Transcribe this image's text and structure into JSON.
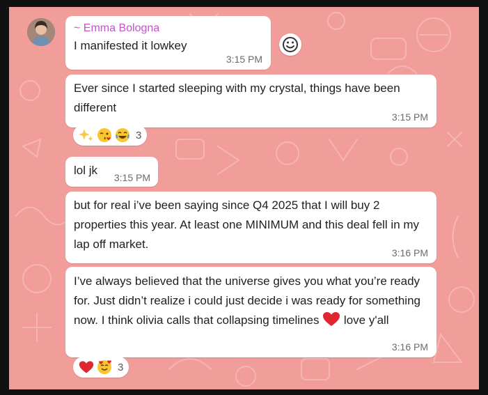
{
  "sender": {
    "name": "~ Emma Bologna"
  },
  "messages": [
    {
      "text": "I manifested it lowkey",
      "time": "3:15 PM"
    },
    {
      "text": "Ever since I started sleeping with my crystal, things have been different",
      "time": "3:15 PM"
    },
    {
      "text": "lol jk",
      "time": "3:15 PM"
    },
    {
      "text": "but for real i’ve been saying since Q4 2025 that I will buy 2 properties this year. At least one MINIMUM and this deal fell in my lap off market.",
      "time": "3:16 PM"
    },
    {
      "text_before_emoji": "I’ve always believed that the universe gives you what you’re ready for. Just didn’t realize i could just decide i was ready for something now. I think olivia calls that collapsing timelines ",
      "text_after_emoji": " love y'all",
      "time": "3:16 PM"
    }
  ],
  "reactions": [
    {
      "icons": [
        "sparkles-emoji",
        "winking-kiss-emoji",
        "tears-of-joy-emoji"
      ],
      "count": "3"
    },
    {
      "icons": [
        "red-heart-emoji",
        "smiling-face-with-hearts-emoji"
      ],
      "count": "3"
    }
  ],
  "colors": {
    "wallpaper": "#f19d9a",
    "bubble": "#ffffff",
    "sender_name": "#c94fd0",
    "timestamp": "#6b6b6b",
    "heart": "#e0262e"
  }
}
